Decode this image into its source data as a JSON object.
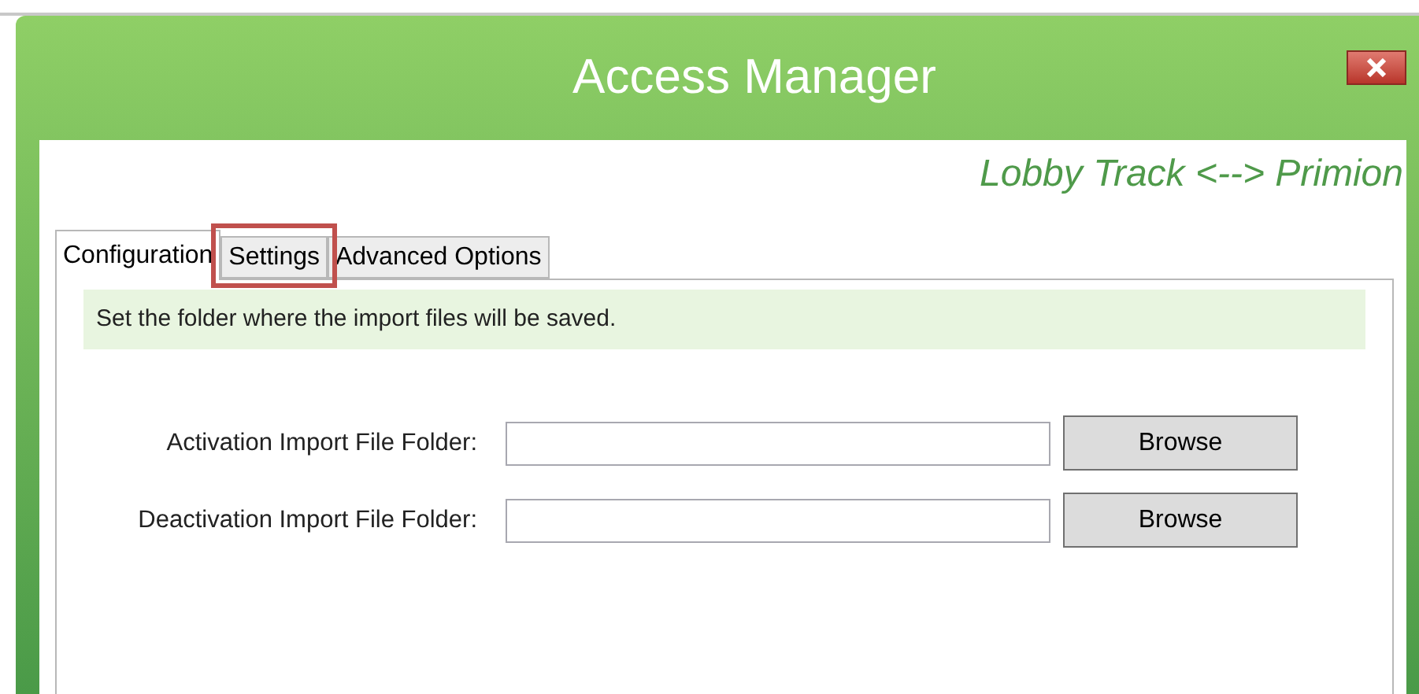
{
  "window": {
    "title": "Access Manager",
    "subtitle": "Lobby Track <--> Primion"
  },
  "tabs": [
    {
      "label": "Configuration",
      "selected": true,
      "highlighted": false
    },
    {
      "label": "Settings",
      "selected": false,
      "highlighted": true
    },
    {
      "label": "Advanced Options",
      "selected": false,
      "highlighted": false
    }
  ],
  "note": "Set the folder where the import files will be saved.",
  "fields": [
    {
      "label": "Activation Import File Folder:",
      "button": "Browse"
    },
    {
      "label": "Deactivation Import File Folder:",
      "button": "Browse"
    }
  ]
}
